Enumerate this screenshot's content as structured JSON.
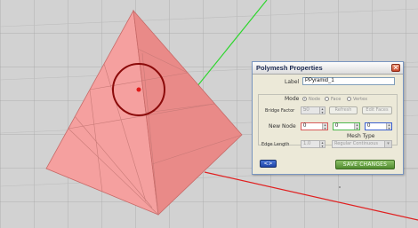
{
  "dialog": {
    "title": "Polymesh Properties",
    "close_label": "✕",
    "label_caption": "Label",
    "label_value": "PPyramid_1",
    "mode_caption": "Mode",
    "mode_options": [
      "Node",
      "Face",
      "Vertex"
    ],
    "mode_selected": "Node",
    "bridge_caption": "Bridge Factor",
    "bridge_value": "50",
    "refresh_label": "Refresh",
    "edit_faces_label": "Edit Faces",
    "new_node_caption": "New Node",
    "new_node_x": "0",
    "new_node_y": "0",
    "new_node_z": "0",
    "mesh_type_caption": "Mesh Type",
    "edge_length_caption": "Edge Length",
    "edge_length_value": "1.0",
    "mesh_type_value": "Regular Continuous",
    "link_label": "<>",
    "save_label": "SAVE CHANGES"
  },
  "colors": {
    "pyramid_left": "#f5a09f",
    "pyramid_right": "#e98a88",
    "axis_green": "#2fd62f",
    "axis_red": "#e02020",
    "gizmo": "#8b0a0a",
    "save_button": "#5f9a3a"
  }
}
